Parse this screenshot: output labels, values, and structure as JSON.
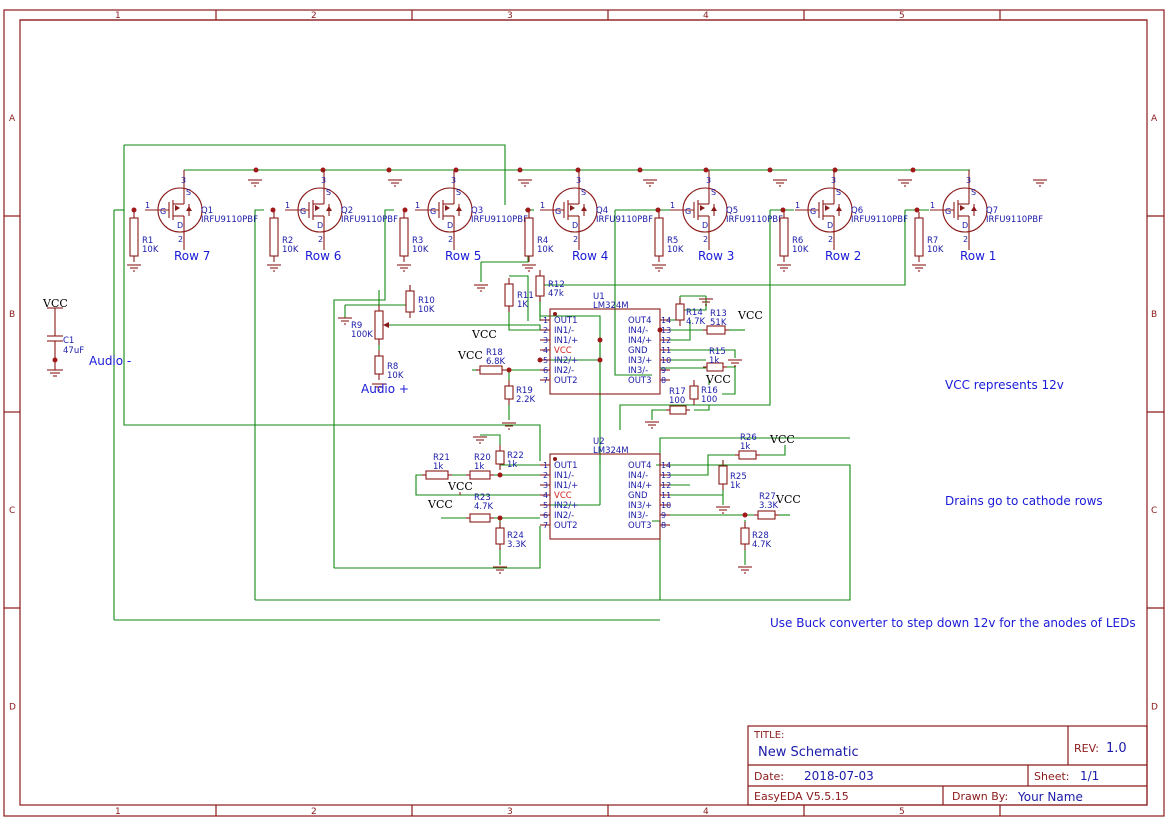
{
  "zones": {
    "cols": [
      "1",
      "2",
      "3",
      "4",
      "5"
    ],
    "rows": [
      "A",
      "B",
      "C",
      "D"
    ]
  },
  "mosfet_model": "IRFU9110PBF",
  "mosfets": [
    {
      "ref": "Q1",
      "row": "Row 7",
      "r": "R1",
      "rv": "10K"
    },
    {
      "ref": "Q2",
      "row": "Row 6",
      "r": "R2",
      "rv": "10K"
    },
    {
      "ref": "Q3",
      "row": "Row 5",
      "r": "R3",
      "rv": "10K"
    },
    {
      "ref": "Q4",
      "row": "Row 4",
      "r": "R4",
      "rv": "10K"
    },
    {
      "ref": "Q5",
      "row": "Row 3",
      "r": "R5",
      "rv": "10K"
    },
    {
      "ref": "Q6",
      "row": "Row 2",
      "r": "R6",
      "rv": "10K"
    },
    {
      "ref": "Q7",
      "row": "Row 1",
      "r": "R7",
      "rv": "10K"
    }
  ],
  "pin_letters": {
    "g": "G",
    "d": "D",
    "s": "S",
    "one": "1",
    "two": "2",
    "three": "3"
  },
  "vcc": "VCC",
  "cap": {
    "ref": "C1",
    "val": "47uF"
  },
  "audio_minus": "Audio -",
  "audio_plus": "Audio +",
  "resistors": {
    "r8": {
      "ref": "R8",
      "val": "10K"
    },
    "r9": {
      "ref": "R9",
      "val": "100K"
    },
    "r10": {
      "ref": "R10",
      "val": "10K"
    },
    "r11": {
      "ref": "R11",
      "val": "1K"
    },
    "r12": {
      "ref": "R12",
      "val": "47k"
    },
    "r13": {
      "ref": "R13",
      "val": "51K"
    },
    "r14": {
      "ref": "R14",
      "val": "4.7K"
    },
    "r15": {
      "ref": "R15",
      "val": "1k"
    },
    "r16": {
      "ref": "R16",
      "val": "100"
    },
    "r17": {
      "ref": "R17",
      "val": "100"
    },
    "r18": {
      "ref": "R18",
      "val": "6.8K"
    },
    "r19": {
      "ref": "R19",
      "val": "2.2K"
    },
    "r20": {
      "ref": "R20",
      "val": "1k"
    },
    "r21": {
      "ref": "R21",
      "val": "1k"
    },
    "r22": {
      "ref": "R22",
      "val": "1k"
    },
    "r23": {
      "ref": "R23",
      "val": "4.7K"
    },
    "r24": {
      "ref": "R24",
      "val": "3.3K"
    },
    "r25": {
      "ref": "R25",
      "val": "1k"
    },
    "r26": {
      "ref": "R26",
      "val": "1k"
    },
    "r27": {
      "ref": "R27",
      "val": "3.3K"
    },
    "r28": {
      "ref": "R28",
      "val": "4.7K"
    }
  },
  "u1": {
    "ref": "U1",
    "model": "LM324M"
  },
  "u2": {
    "ref": "U2",
    "model": "LM324M"
  },
  "ic_left": [
    {
      "n": "1",
      "name": "OUT1"
    },
    {
      "n": "2",
      "name": "IN1/-"
    },
    {
      "n": "3",
      "name": "IN1/+"
    },
    {
      "n": "4",
      "name": "VCC"
    },
    {
      "n": "5",
      "name": "IN2/+"
    },
    {
      "n": "6",
      "name": "IN2/-"
    },
    {
      "n": "7",
      "name": "OUT2"
    }
  ],
  "ic_right": [
    {
      "n": "14",
      "name": "OUT4"
    },
    {
      "n": "13",
      "name": "IN4/-"
    },
    {
      "n": "12",
      "name": "IN4/+"
    },
    {
      "n": "11",
      "name": "GND"
    },
    {
      "n": "10",
      "name": "IN3/+"
    },
    {
      "n": "9",
      "name": "IN3/-"
    },
    {
      "n": "8",
      "name": "OUT3"
    }
  ],
  "notes": {
    "vcc12": "VCC represents 12v",
    "drains": "Drains go to cathode rows",
    "buck": "Use Buck converter to step down 12v for the anodes of LEDs"
  },
  "title_block": {
    "title_label": "TITLE:",
    "title": "New Schematic",
    "rev_label": "REV:",
    "rev": "1.0",
    "date_label": "Date:",
    "date": "2018-07-03",
    "sheet_label": "Sheet:",
    "sheet": "1/1",
    "tool": "EasyEDA V5.5.15",
    "drawn_label": "Drawn By:",
    "drawn_by": "Your Name"
  },
  "colors": {
    "frame": "#8b1a1a",
    "wire": "#118811",
    "text": "#1a1aa8"
  }
}
